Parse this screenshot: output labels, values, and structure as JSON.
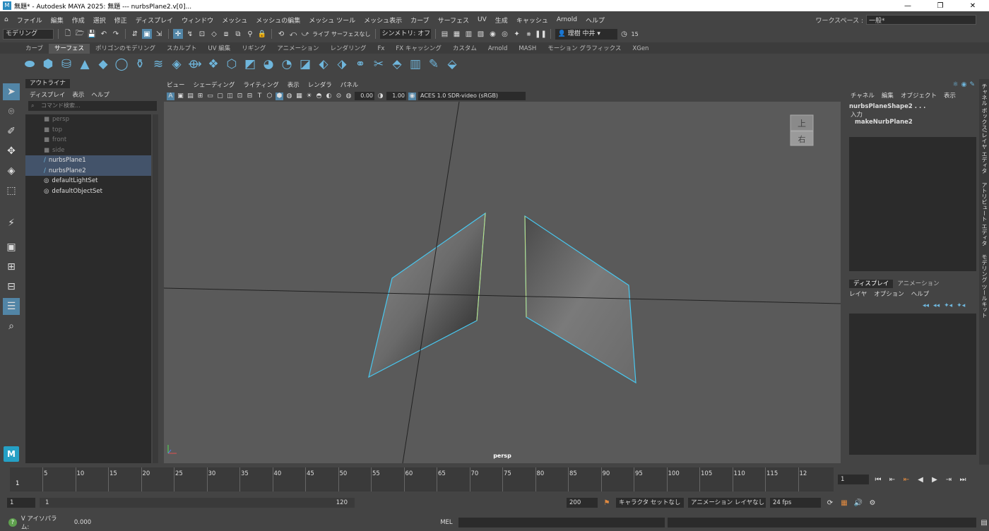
{
  "window": {
    "title": "無題* - Autodesk MAYA 2025: 無題   ---   nurbsPlane2.v[0]...",
    "controls": [
      "—",
      "❐",
      "✕"
    ]
  },
  "menubar": {
    "items": [
      "ファイル",
      "編集",
      "作成",
      "選択",
      "修正",
      "ディスプレイ",
      "ウィンドウ",
      "メッシュ",
      "メッシュの編集",
      "メッシュ ツール",
      "メッシュ表示",
      "カーブ",
      "サーフェス",
      "UV",
      "生成",
      "キャッシュ",
      "Arnold",
      "ヘルプ"
    ],
    "workspace_label": "ワークスペース :",
    "workspace_value": "一般*"
  },
  "statusline": {
    "mode": "モデリング",
    "live_label": "ライブ",
    "surface_label": "サーフェスなし",
    "symmetry": "シンメトリ: オフ",
    "user": "理樹 中井",
    "frames_count": "15"
  },
  "shelf": {
    "tabs": [
      "カーブ",
      "サーフェス",
      "ポリゴンのモデリング",
      "スカルプト",
      "UV 編集",
      "リギング",
      "アニメーション",
      "レンダリング",
      "Fx",
      "FX キャッシング",
      "カスタム",
      "Arnold",
      "MASH",
      "モーション グラフィックス",
      "XGen"
    ],
    "active_tab": "サーフェス",
    "icons": [
      "sphere-icon",
      "cube-icon",
      "cylinder-icon",
      "cone-icon",
      "plane-icon",
      "torus-icon",
      "revolve-icon",
      "loft-icon",
      "planar-icon",
      "extrude-icon",
      "birail-icon",
      "boundary-icon",
      "square-icon",
      "bevel-icon",
      "intersect-icon",
      "project-icon",
      "trim-icon",
      "untrim-icon",
      "attach-icon",
      "detach-icon",
      "align-icon",
      "open-close-icon",
      "insert-isoparm-icon",
      "extend-icon",
      "rebuild-icon",
      "reverse-icon",
      "sculpt-icon",
      "convert-icon"
    ]
  },
  "outliner": {
    "tab": "アウトライナ",
    "menu": [
      "ディスプレイ",
      "表示",
      "ヘルプ"
    ],
    "search_placeholder": "コマンド検索...",
    "items": [
      {
        "label": "persp",
        "type": "camera",
        "dim": true,
        "selected": false
      },
      {
        "label": "top",
        "type": "camera",
        "dim": true,
        "selected": false
      },
      {
        "label": "front",
        "type": "camera",
        "dim": true,
        "selected": false
      },
      {
        "label": "side",
        "type": "camera",
        "dim": true,
        "selected": false
      },
      {
        "label": "nurbsPlane1",
        "type": "nurbs",
        "dim": false,
        "selected": true
      },
      {
        "label": "nurbsPlane2",
        "type": "nurbs",
        "dim": false,
        "selected": true
      },
      {
        "label": "defaultLightSet",
        "type": "set",
        "dim": false,
        "selected": false
      },
      {
        "label": "defaultObjectSet",
        "type": "set",
        "dim": false,
        "selected": false
      }
    ]
  },
  "viewport": {
    "menu": [
      "ビュー",
      "シェーディング",
      "ライティング",
      "表示",
      "レンダラ",
      "パネル"
    ],
    "exposure": "0.00",
    "gamma": "1.00",
    "colorspace": "ACES 1.0 SDR-video (sRGB)",
    "camera_label": "persp",
    "viewcube_top": "上",
    "viewcube_right": "右"
  },
  "channelbox": {
    "menu": [
      "チャネル",
      "編集",
      "オブジェクト",
      "表示"
    ],
    "node": "nurbsPlaneShape2 . . .",
    "inputs_label": "入力",
    "input_node": "makeNurbPlane2",
    "layer_tabs": [
      "ディスプレイ",
      "アニメーション"
    ],
    "active_layer_tab": "ディスプレイ",
    "layer_menu": [
      "レイヤ",
      "オプション",
      "ヘルプ"
    ]
  },
  "side_tabs": [
    "チャネル ボックス/レイヤ エディタ",
    "アトリビュート エディタ",
    "モデリング ツールキット"
  ],
  "timeline": {
    "ticks": [
      "5",
      "10",
      "15",
      "20",
      "25",
      "30",
      "35",
      "40",
      "45",
      "50",
      "55",
      "60",
      "65",
      "70",
      "75",
      "80",
      "85",
      "90",
      "95",
      "100",
      "105",
      "110",
      "115",
      "12"
    ],
    "current_frame_marker": "1",
    "current_frame": "1"
  },
  "range": {
    "start": "1",
    "inner_start": "1",
    "inner_end": "120",
    "end": "200",
    "character_set": "キャラクタ セットなし",
    "anim_layer": "アニメーション レイヤなし",
    "fps": "24 fps"
  },
  "commandline": {
    "help_text": "V アイソパラム:",
    "help_value": "0.000",
    "lang": "MEL"
  }
}
